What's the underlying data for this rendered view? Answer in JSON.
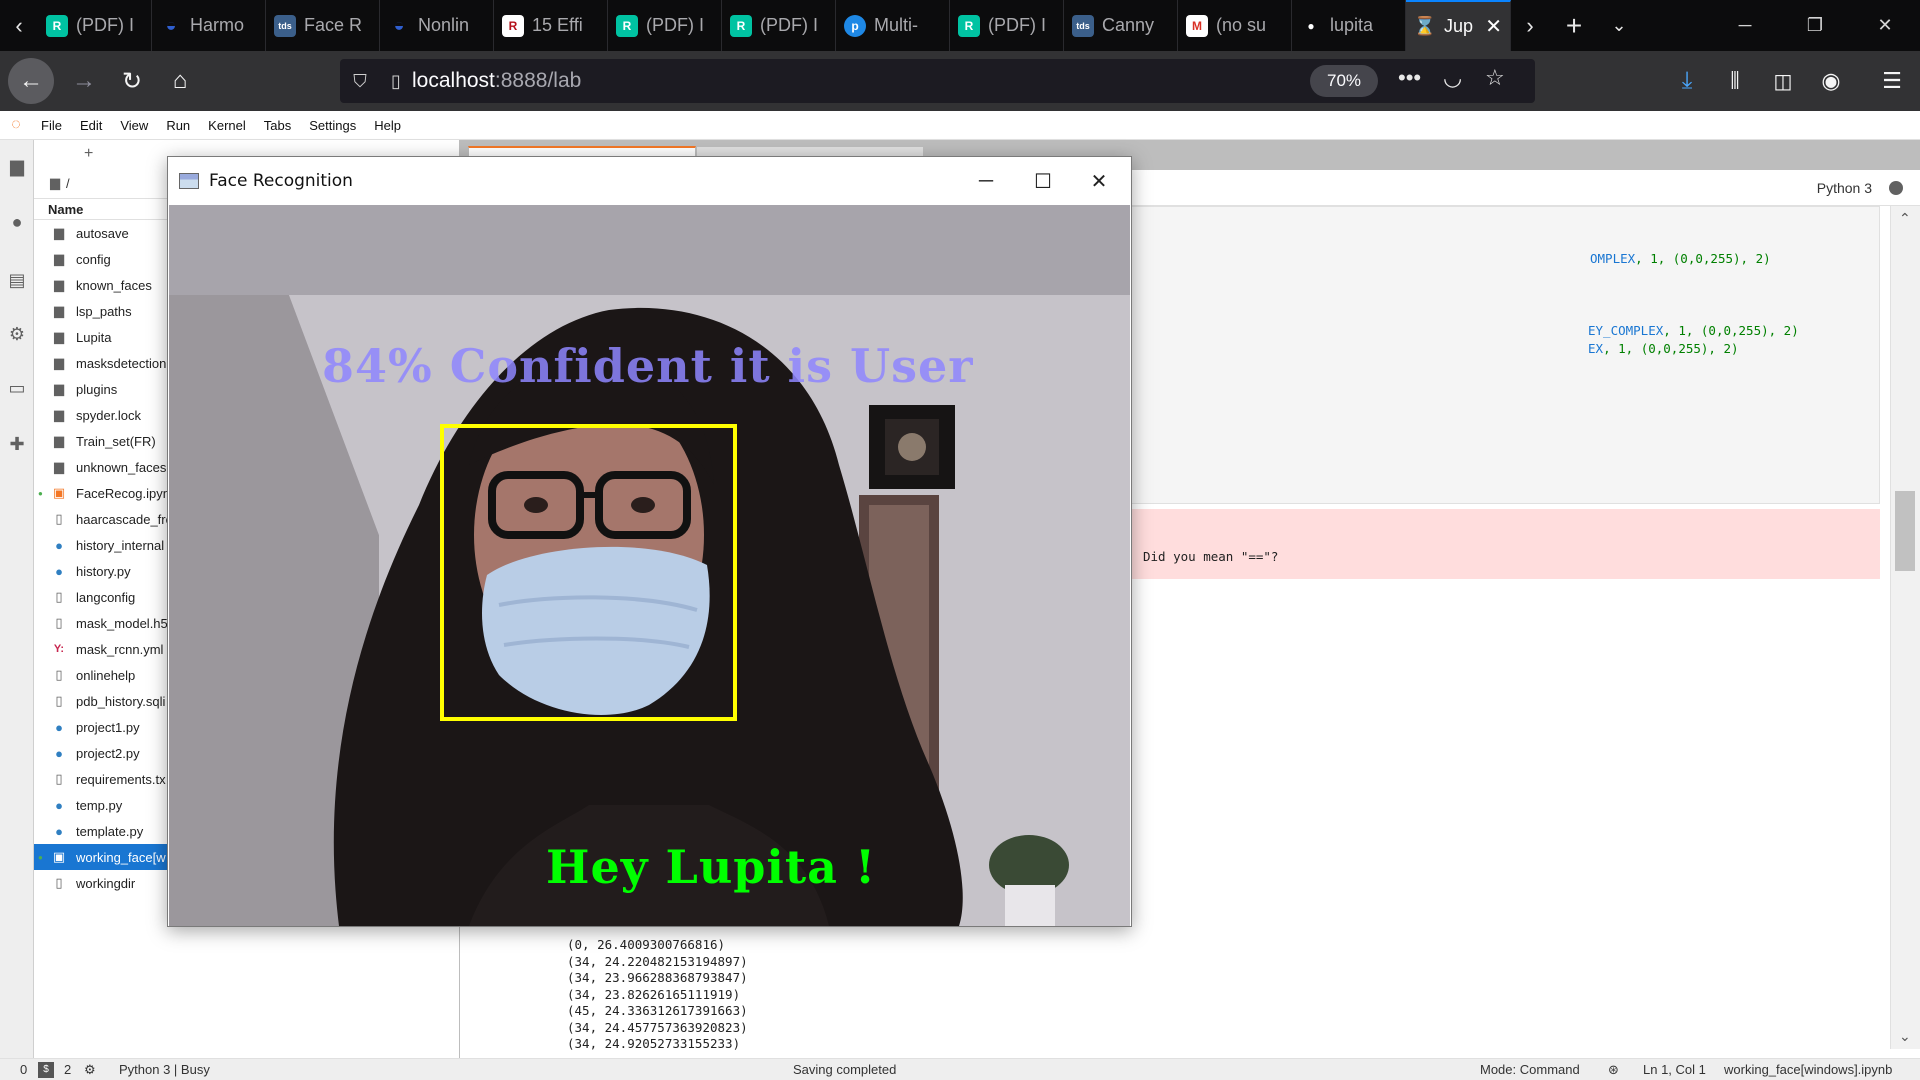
{
  "browser": {
    "tabs": [
      {
        "title": "(PDF) I",
        "icon": "researchgate-icon",
        "color": "#00c3a2"
      },
      {
        "title": "Harmo",
        "icon": "wave-icon",
        "color": "#2f5fd0"
      },
      {
        "title": "Face R",
        "icon": "tds-icon",
        "color": "#3b5f8a"
      },
      {
        "title": "Nonlin",
        "icon": "wave-icon",
        "color": "#2f5fd0"
      },
      {
        "title": "15 Effi",
        "icon": "r-icon",
        "color": "#ffffff"
      },
      {
        "title": "(PDF) I",
        "icon": "researchgate-icon",
        "color": "#00c3a2"
      },
      {
        "title": "(PDF) I",
        "icon": "researchgate-icon",
        "color": "#00c3a2"
      },
      {
        "title": "Multi-",
        "icon": "pi-icon",
        "color": "#1e88e5"
      },
      {
        "title": "(PDF) I",
        "icon": "researchgate-icon",
        "color": "#00c3a2"
      },
      {
        "title": "Canny",
        "icon": "tds-icon",
        "color": "#3b5f8a"
      },
      {
        "title": "(no su",
        "icon": "gmail-icon",
        "color": "#ffffff"
      },
      {
        "title": "lupita",
        "icon": "github-icon",
        "color": "#ffffff"
      }
    ],
    "active_tab": {
      "title": "Jup",
      "icon": "hourglass-icon",
      "color": "#f37726"
    },
    "favicon_letters": {
      "researchgate": "R",
      "tds": "tds",
      "r": "R",
      "pi": "p",
      "gmail": "M",
      "github": "●",
      "wave": "◒",
      "hourglass": "⌛"
    },
    "url_host": "localhost",
    "url_rest": ":8888/lab",
    "zoom": "70%"
  },
  "jupyter": {
    "menu": [
      "File",
      "Edit",
      "View",
      "Run",
      "Kernel",
      "Tabs",
      "Settings",
      "Help"
    ],
    "breadcrumb": "/",
    "column_name": "Name",
    "files": [
      {
        "name": "autosave",
        "type": "folder"
      },
      {
        "name": "config",
        "type": "folder"
      },
      {
        "name": "known_faces",
        "type": "folder"
      },
      {
        "name": "lsp_paths",
        "type": "folder"
      },
      {
        "name": "Lupita",
        "type": "folder"
      },
      {
        "name": "masksdetection",
        "type": "folder"
      },
      {
        "name": "plugins",
        "type": "folder"
      },
      {
        "name": "spyder.lock",
        "type": "folder"
      },
      {
        "name": "Train_set(FR)",
        "type": "folder"
      },
      {
        "name": "unknown_faces",
        "type": "folder"
      },
      {
        "name": "FaceRecog.ipynb",
        "type": "notebook",
        "running": true
      },
      {
        "name": "haarcascade_fro",
        "type": "file"
      },
      {
        "name": "history_internal",
        "type": "python"
      },
      {
        "name": "history.py",
        "type": "python"
      },
      {
        "name": "langconfig",
        "type": "file"
      },
      {
        "name": "mask_model.h5",
        "type": "file"
      },
      {
        "name": "mask_rcnn.yml",
        "type": "yaml"
      },
      {
        "name": "onlinehelp",
        "type": "file"
      },
      {
        "name": "pdb_history.sqli",
        "type": "file"
      },
      {
        "name": "project1.py",
        "type": "python"
      },
      {
        "name": "project2.py",
        "type": "python"
      },
      {
        "name": "requirements.tx",
        "type": "file"
      },
      {
        "name": "temp.py",
        "type": "python"
      },
      {
        "name": "template.py",
        "type": "python"
      },
      {
        "name": "working_face[w",
        "type": "notebook",
        "selected": true,
        "running": true
      },
      {
        "name": "workingdir",
        "type": "file"
      }
    ],
    "kernel": "Python 3",
    "code_lines": [
      {
        "pre": "OMPLEX",
        "rest": ", 1, (0,0,255), 2)"
      },
      {
        "pre": "EY_COMPLEX",
        "rest": ", 1, (0,0,255), 2)"
      },
      {
        "pre": "EX",
        "rest": ", 1, (0,0,255), 2)"
      }
    ],
    "error_text": "Did you mean \"==\"?",
    "output_lines": [
      "(0, 26.4009300766816)",
      "(34, 24.220482153194897)",
      "(34, 23.966288368793847)",
      "(34, 23.82626165111919)",
      "(45, 24.336312617391663)",
      "(34, 24.457757363920823)",
      "(34, 24.92052733155233)"
    ],
    "status": {
      "count_a": "0",
      "count_b": "2",
      "kernel_state": "Python 3 | Busy",
      "message": "Saving completed",
      "mode": "Mode: Command",
      "position": "Ln 1, Col 1",
      "file": "working_face[windows].ipynb"
    }
  },
  "face_window": {
    "title": "Face Recognition",
    "confidence_text": "84% Confident it is User",
    "greeting_text": "Hey Lupita !",
    "colors": {
      "confidence": "#8f86ff",
      "greeting": "#00ff00",
      "box": "#ffff00"
    }
  }
}
